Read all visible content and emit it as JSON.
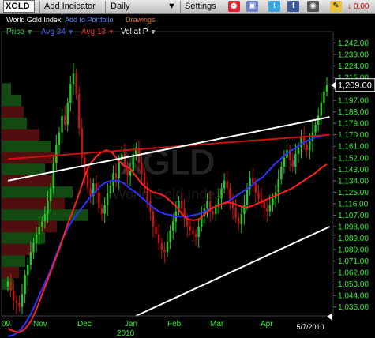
{
  "toolbar": {
    "symbol": "XGLD",
    "add_indicator": "Add Indicator",
    "interval": "Daily",
    "settings": "Settings",
    "change": "0.00"
  },
  "info": {
    "name": "World Gold Index",
    "add_portfolio": "Add to Portfolio",
    "drawings": "Drawings"
  },
  "legend": {
    "price": "Price",
    "avg34": "Avg 34",
    "avg13": "Avg 13",
    "vol": "Vol at P"
  },
  "watermark": "XGLD",
  "watermark_sub": "World Gold Index",
  "colors": {
    "up": "#22cc22",
    "down": "#cc1111",
    "avg34": "#3030ff",
    "avg13": "#ff2020",
    "trend": "#ffffff",
    "resist": "#cc1111",
    "axis_text": "#33ee33"
  },
  "chart_data": {
    "type": "candlestick",
    "ylim": [
      1028,
      1246
    ],
    "yticks": [
      1035,
      1044,
      1053,
      1062,
      1071,
      1080,
      1089,
      1098,
      1107,
      1116,
      1125,
      1134,
      1143,
      1152,
      1161,
      1170,
      1179,
      1188,
      1197,
      1206,
      1215,
      1224,
      1233,
      1242
    ],
    "ytick_labels": [
      "1,035.00",
      "1,044.00",
      "1,053.00",
      "1,062.00",
      "1,071.00",
      "1,080.00",
      "1,089.00",
      "1,098.00",
      "1,107.00",
      "1,116.00",
      "1,125.00",
      "1,134.00",
      "1,143.00",
      "1,152.00",
      "1,161.00",
      "1,170.00",
      "1,179.00",
      "1,188.00",
      "1,197.00",
      "1,206.00",
      "1,215.00",
      "1,224.00",
      "1,233.00",
      "1,242.00"
    ],
    "xaxis_labels": [
      "09",
      "Nov",
      "Dec",
      "Jan",
      "Feb",
      "Mar",
      "Apr",
      "5/7/2010"
    ],
    "xaxis_year": "2010",
    "last_price": 1209,
    "last_price_label": "1,209.00",
    "closes": [
      1055,
      1048,
      1040,
      1038,
      1035,
      1045,
      1060,
      1068,
      1078,
      1085,
      1092,
      1098,
      1102,
      1108,
      1118,
      1128,
      1148,
      1162,
      1172,
      1185,
      1178,
      1195,
      1210,
      1218,
      1202,
      1175,
      1152,
      1140,
      1128,
      1122,
      1132,
      1125,
      1112,
      1108,
      1115,
      1124,
      1130,
      1140,
      1136,
      1150,
      1155,
      1145,
      1138,
      1142,
      1155,
      1160,
      1148,
      1140,
      1128,
      1118,
      1110,
      1098,
      1092,
      1085,
      1080,
      1078,
      1086,
      1095,
      1102,
      1110,
      1118,
      1112,
      1104,
      1098,
      1095,
      1092,
      1090,
      1098,
      1106,
      1112,
      1118,
      1110,
      1108,
      1115,
      1120,
      1128,
      1134,
      1128,
      1118,
      1112,
      1105,
      1100,
      1108,
      1115,
      1128,
      1136,
      1132,
      1125,
      1120,
      1118,
      1112,
      1110,
      1115,
      1120,
      1125,
      1135,
      1145,
      1152,
      1158,
      1150,
      1145,
      1155,
      1160,
      1168,
      1162,
      1158,
      1165,
      1172,
      1178,
      1185,
      1195,
      1204,
      1209
    ],
    "avg13": [
      1018,
      1016,
      1015,
      1018,
      1024,
      1034,
      1046,
      1058,
      1070,
      1082,
      1096,
      1108,
      1120,
      1134,
      1146,
      1152,
      1156,
      1158,
      1156,
      1150,
      1146,
      1144,
      1138,
      1132,
      1128,
      1125,
      1124,
      1122,
      1118,
      1114,
      1108,
      1104,
      1103,
      1104,
      1108,
      1112,
      1114,
      1116,
      1117,
      1116,
      1114,
      1113,
      1114,
      1116,
      1118,
      1120,
      1122,
      1124,
      1126,
      1128,
      1131,
      1134,
      1137,
      1140,
      1144,
      1147
    ],
    "avg34": [
      1012,
      1013,
      1016,
      1022,
      1030,
      1040,
      1050,
      1060,
      1072,
      1084,
      1094,
      1102,
      1108,
      1114,
      1120,
      1125,
      1130,
      1133,
      1134,
      1134,
      1132,
      1128,
      1125,
      1121,
      1117,
      1113,
      1110,
      1108,
      1107,
      1106,
      1106,
      1106,
      1107,
      1108,
      1110,
      1112,
      1114,
      1116,
      1118,
      1121,
      1124,
      1127,
      1130,
      1134,
      1137,
      1142,
      1147,
      1151,
      1155,
      1158,
      1161,
      1164,
      1166,
      1168,
      1169,
      1170
    ],
    "white_trendline": [
      [
        0,
        1134
      ],
      [
        113,
        1184
      ]
    ],
    "red_resistance": [
      [
        0,
        1151
      ],
      [
        113,
        1170
      ]
    ],
    "lower_channel": [
      [
        45,
        1028
      ],
      [
        113,
        1098
      ]
    ],
    "volume_profile": [
      [
        1161,
        62,
        "g"
      ],
      [
        1152,
        72,
        "r"
      ],
      [
        1143,
        55,
        "g"
      ],
      [
        1134,
        66,
        "r"
      ],
      [
        1125,
        90,
        "g"
      ],
      [
        1116,
        80,
        "r"
      ],
      [
        1107,
        110,
        "g"
      ],
      [
        1098,
        70,
        "r"
      ],
      [
        1089,
        55,
        "g"
      ],
      [
        1080,
        40,
        "r"
      ],
      [
        1071,
        30,
        "g"
      ],
      [
        1062,
        22,
        "r"
      ],
      [
        1053,
        15,
        "g"
      ],
      [
        1197,
        25,
        "g"
      ],
      [
        1188,
        28,
        "r"
      ],
      [
        1179,
        32,
        "g"
      ],
      [
        1170,
        48,
        "r"
      ],
      [
        1206,
        12,
        "g"
      ]
    ]
  }
}
